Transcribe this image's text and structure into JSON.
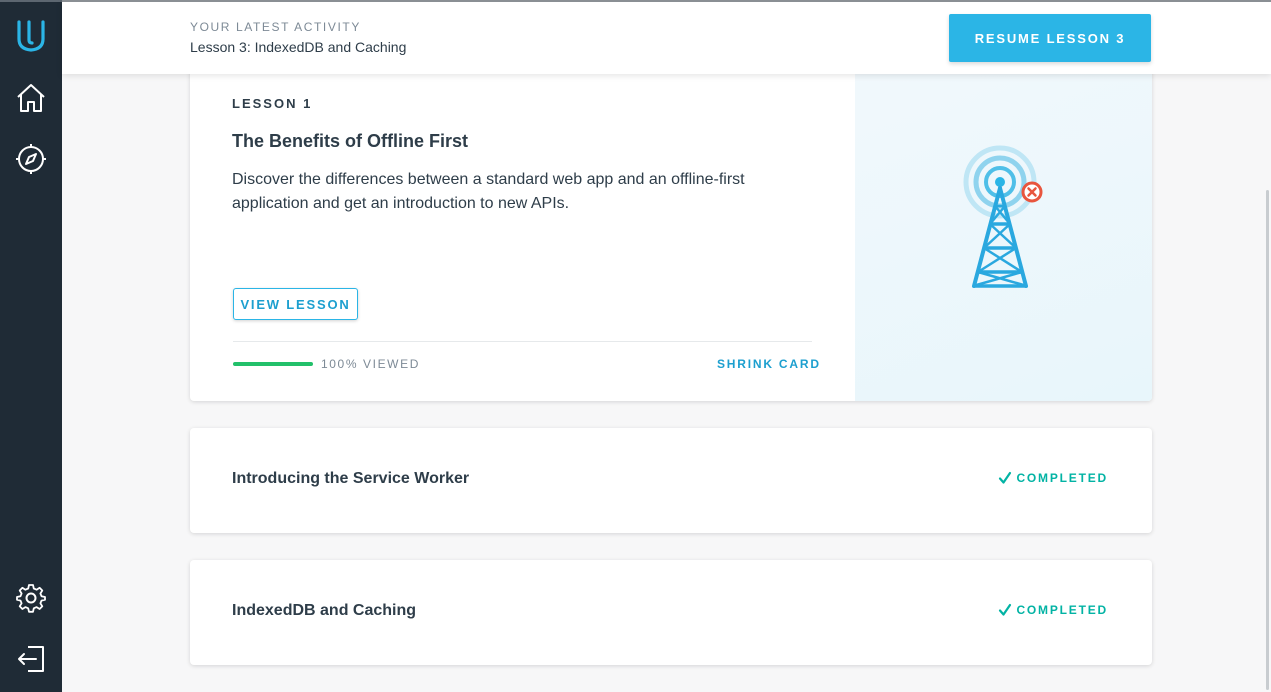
{
  "app": {
    "brand": "Udacity",
    "accent": "#2bb5e6",
    "success": "#02b3a4"
  },
  "sidebar": {
    "items": [
      {
        "name": "udacity-logo",
        "icon": "udacity-u-icon"
      },
      {
        "name": "home",
        "icon": "home-icon"
      },
      {
        "name": "explore",
        "icon": "compass-icon"
      },
      {
        "name": "settings",
        "icon": "gear-icon"
      },
      {
        "name": "logout",
        "icon": "logout-icon"
      }
    ]
  },
  "header": {
    "activity_label": "YOUR LATEST ACTIVITY",
    "activity_title": "Lesson 3: IndexedDB and Caching",
    "resume_label": "RESUME LESSON 3"
  },
  "lessons": {
    "expanded": {
      "kicker": "LESSON 1",
      "title": "The Benefits of Offline First",
      "description": "Discover the differences between a standard web app and an offline-first application and get an introduction to new APIs.",
      "view_label": "VIEW LESSON",
      "progress": 1.0,
      "progress_text": "100% VIEWED",
      "shrink_label": "SHRINK CARD",
      "art_icon": "radio-tower-offline-icon"
    },
    "collapsed": [
      {
        "title": "Introducing the Service Worker",
        "status": "COMPLETED"
      },
      {
        "title": "IndexedDB and Caching",
        "status": "COMPLETED"
      }
    ]
  }
}
